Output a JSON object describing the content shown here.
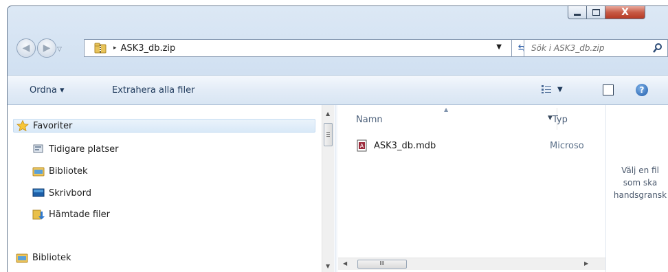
{
  "window": {
    "caption_buttons": {
      "close_glyph": "X"
    }
  },
  "navigation": {
    "back_glyph": "◀",
    "forward_glyph": "▶"
  },
  "address": {
    "breadcrumb_separator": "▸",
    "path": "ASK3_db.zip"
  },
  "search": {
    "placeholder": "Sök i ASK3_db.zip"
  },
  "toolbar": {
    "organize_label": "Ordna ▾",
    "extract_label": "Extrahera alla filer",
    "help_glyph": "?"
  },
  "nav_pane": {
    "favorites_label": "Favoriter",
    "items": [
      {
        "label": "Tidigare platser",
        "icon": "recent-places-icon"
      },
      {
        "label": "Bibliotek",
        "icon": "library-icon"
      },
      {
        "label": "Skrivbord",
        "icon": "desktop-icon"
      },
      {
        "label": "Hämtade filer",
        "icon": "downloads-icon"
      }
    ],
    "libraries_label": "Bibliotek"
  },
  "file_list": {
    "columns": {
      "name": "Namn",
      "type": "Typ"
    },
    "rows": [
      {
        "name": "ASK3_db.mdb",
        "type": "Microso"
      }
    ],
    "scroll_grip": "III"
  },
  "preview": {
    "line1": "Välj en fil",
    "line2": "som ska",
    "line3": "handsgransk"
  }
}
